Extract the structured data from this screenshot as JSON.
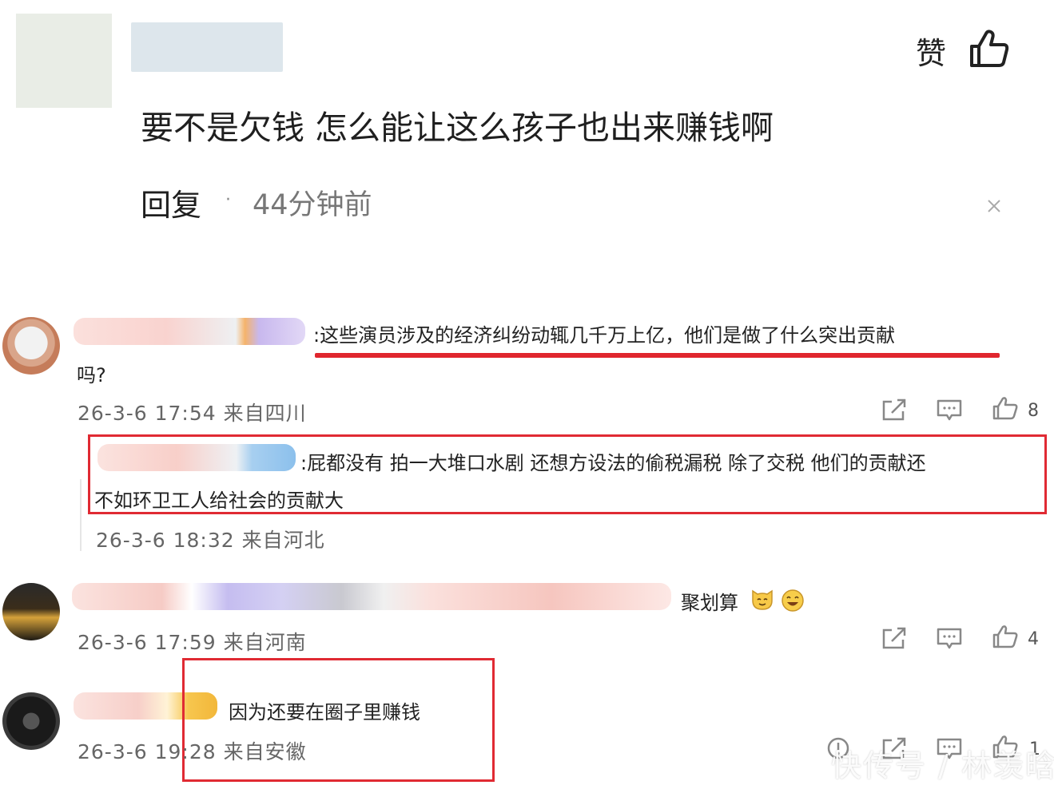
{
  "top_comment": {
    "like_label": "赞",
    "text": "要不是欠钱 怎么能让这么孩子也出来赚钱啊",
    "reply_label": "回复",
    "separator": "·",
    "time_ago": "44分钟前"
  },
  "comments": [
    {
      "text_line1": ":这些演员涉及的经济纠纷动辄几千万上亿，他们是做了什么突出贡献",
      "text_line2": "吗?",
      "meta": "26-3-6 17:54 来自四川",
      "likes": "8",
      "reply": {
        "text_line1": ":屁都没有 拍一大堆口水剧 还想方设法的偷税漏税 除了交税 他们的贡献还",
        "text_line2": "不如环卫工人给社会的贡献大",
        "meta": "26-3-6 18:32 来自河北"
      }
    },
    {
      "text": "聚划算",
      "meta": "26-3-6 17:59 来自河南",
      "likes": "4"
    },
    {
      "text": "因为还要在圈子里赚钱",
      "meta": "26-3-6 19:28 来自安徽",
      "likes": "1"
    }
  ],
  "watermark": "快传号 / 林羡晗",
  "colors": {
    "highlight_red": "#e0262e",
    "text_dark": "#1f1f1f",
    "text_meta": "#666666"
  }
}
